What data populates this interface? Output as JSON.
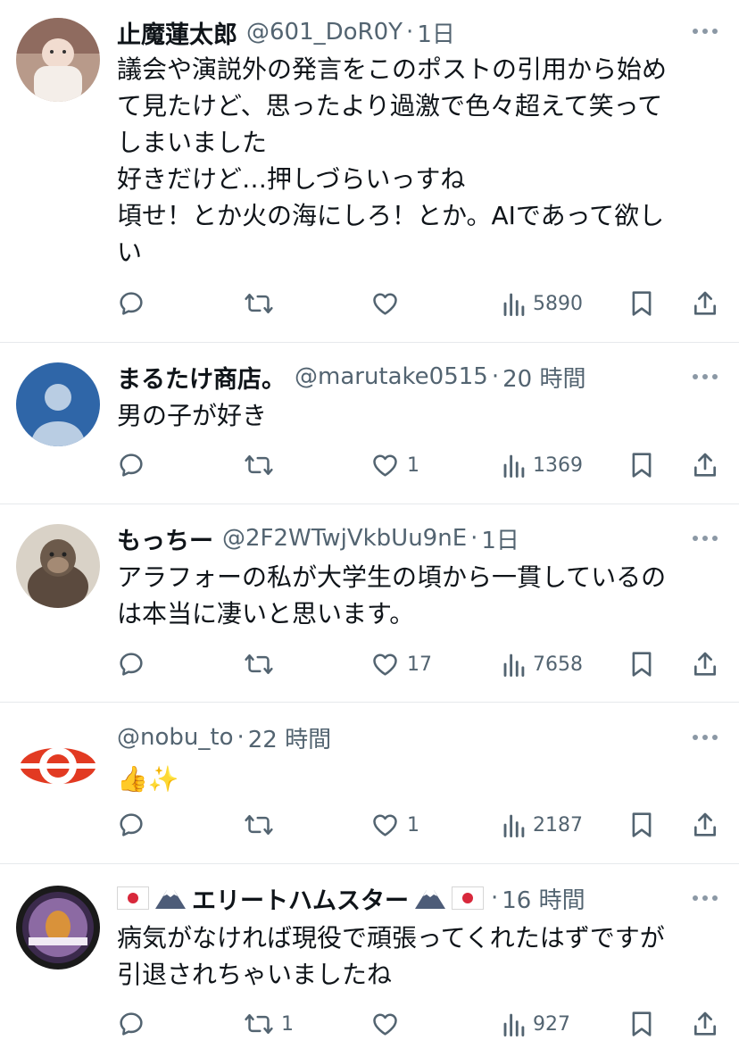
{
  "posts": [
    {
      "name": "止魔蓮太郎",
      "handle": "@601_DoR0Y",
      "separator": "·",
      "time": "1日",
      "text": "議会や演説外の発言をこのポストの引用から始め\nて見たけど、思ったより過激で色々超えて笑って\nしまいました\n好きだけど…押しづらいっすね\n頃せ！とか火の海にしろ！とか。AIであって欲し\nい",
      "reply_count": "",
      "repost_count": "",
      "like_count": "",
      "views": "5890"
    },
    {
      "name": "まるたけ商店。",
      "handle": "@marutake0515",
      "separator": "·",
      "time": "20 時間",
      "text": "男の子が好き",
      "reply_count": "",
      "repost_count": "",
      "like_count": "1",
      "views": "1369"
    },
    {
      "name": "もっちー",
      "handle": "@2F2WTwjVkbUu9nE",
      "separator": "·",
      "time": "1日",
      "text": "アラフォーの私が大学生の頃から一貫しているの\nは本当に凄いと思います。",
      "reply_count": "",
      "repost_count": "",
      "like_count": "17",
      "views": "7658"
    },
    {
      "name": "",
      "handle": "@nobu_to",
      "separator": "·",
      "time": "22 時間",
      "text": "👍✨",
      "reply_count": "",
      "repost_count": "",
      "like_count": "1",
      "views": "2187"
    },
    {
      "name": "エリートハムスター",
      "handle": "",
      "separator": "·",
      "time": "16 時間",
      "text": "病気がなければ現役で頑張ってくれたはずですが\n引退されちゃいましたね",
      "reply_count": "",
      "repost_count": "1",
      "like_count": "",
      "views": "927"
    }
  ],
  "icons": {
    "reply": "reply-icon",
    "repost": "repost-icon",
    "like": "heart-icon",
    "views": "views-icon",
    "bookmark": "bookmark-icon",
    "share": "share-icon",
    "more": "more-icon"
  },
  "colors": {
    "text": "#0f1419",
    "secondary": "#536471",
    "divider": "#e6e9ec"
  }
}
